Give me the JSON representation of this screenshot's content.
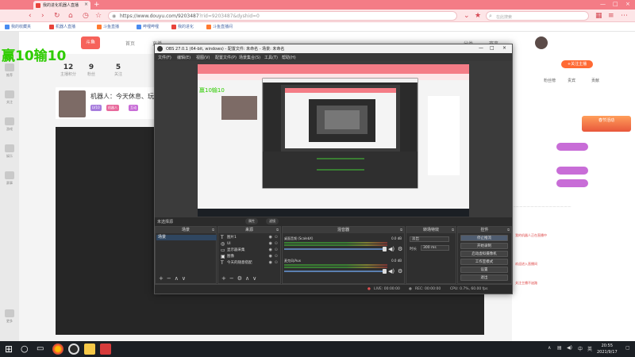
{
  "browser": {
    "tab_title": "我的进化机器人直播",
    "url": "https://www.douyu.com/9203487",
    "url_suffix": "?rid=9203487&dyshid=0",
    "search_placeholder": "在此搜索",
    "bookmarks": [
      {
        "label": "我的收藏夹",
        "color": "#4a8cf0"
      },
      {
        "label": "机器人直播",
        "color": "#e8433b"
      },
      {
        "label": "斗鱼直播",
        "color": "#ff7a30"
      },
      {
        "label": "哔哩哔哩",
        "color": "#4a8cf0"
      },
      {
        "label": "我的进化",
        "color": "#e8433b"
      },
      {
        "label": "斗鱼直播间",
        "color": "#ff7a30"
      }
    ]
  },
  "page": {
    "score_overlay": "赢10输10",
    "nav": [
      "首页",
      "直播",
      "分类",
      "赛事"
    ],
    "stats": [
      {
        "value": "12",
        "label": "主播积分"
      },
      {
        "value": "9",
        "label": "粉丝"
      },
      {
        "value": "5",
        "label": "关注"
      }
    ],
    "room_title": "机器人：今天休息、玩一",
    "chips": [
      "LV10",
      "机器人",
      "互动"
    ],
    "follow_label": "+关注主播",
    "right_tabs": [
      "粉丝榜",
      "贵宾",
      "贡献"
    ],
    "promo_label": "春节活动",
    "chat_lines": [
      "我的机器人正在直播中",
      "欢迎进入直播间",
      "关注主播不迷路"
    ],
    "left_labels": [
      "推荐",
      "关注",
      "游戏",
      "娱乐",
      "赛事",
      "更多"
    ]
  },
  "obs": {
    "title": "OBS 27.0.1 (64-bit, windows) - 配置文件: 未命名 - 场景: 未命名",
    "menu": [
      "文件(F)",
      "编辑(E)",
      "视图(V)",
      "配置文件(P)",
      "场景集合(S)",
      "工具(T)",
      "帮助(H)"
    ],
    "preview_label": "未选择源",
    "preview_buttons": [
      "属性",
      "滤镜"
    ],
    "inner_overlay": "赢10输10",
    "docks": {
      "scenes": {
        "header": "场景",
        "items": [
          "场景"
        ]
      },
      "sources": {
        "header": "来源",
        "items": [
          {
            "label": "图片1",
            "icon": "text-icon"
          },
          {
            "label": "UI",
            "icon": "game-icon"
          },
          {
            "label": "显示器采集",
            "icon": "display-icon"
          },
          {
            "label": "图像",
            "icon": "image-icon"
          },
          {
            "label": "今天的随意搭配",
            "icon": "text-icon"
          }
        ]
      },
      "mixer": {
        "header": "混音器",
        "channels": [
          {
            "name": "桌面音频 (ScalebX)",
            "db": "0.0 dB"
          },
          {
            "name": "麦克风/Aux",
            "db": "0.0 dB"
          }
        ]
      },
      "transitions": {
        "header": "转场特效",
        "transition": "淡出",
        "duration_label": "时长",
        "duration_value": "300 ms"
      },
      "controls": {
        "header": "控件",
        "buttons": [
          "停止推流",
          "开始录制",
          "启动虚拟摄像机",
          "工作室模式",
          "设置",
          "退出"
        ]
      }
    },
    "status": {
      "live": "LIVE: 00:00:00",
      "rec": "REC: 00:00:00",
      "cpu": "CPU: 0.7%, 60.00 fps"
    }
  },
  "taskbar": {
    "time": "20:55",
    "date": "2021/9/17"
  }
}
